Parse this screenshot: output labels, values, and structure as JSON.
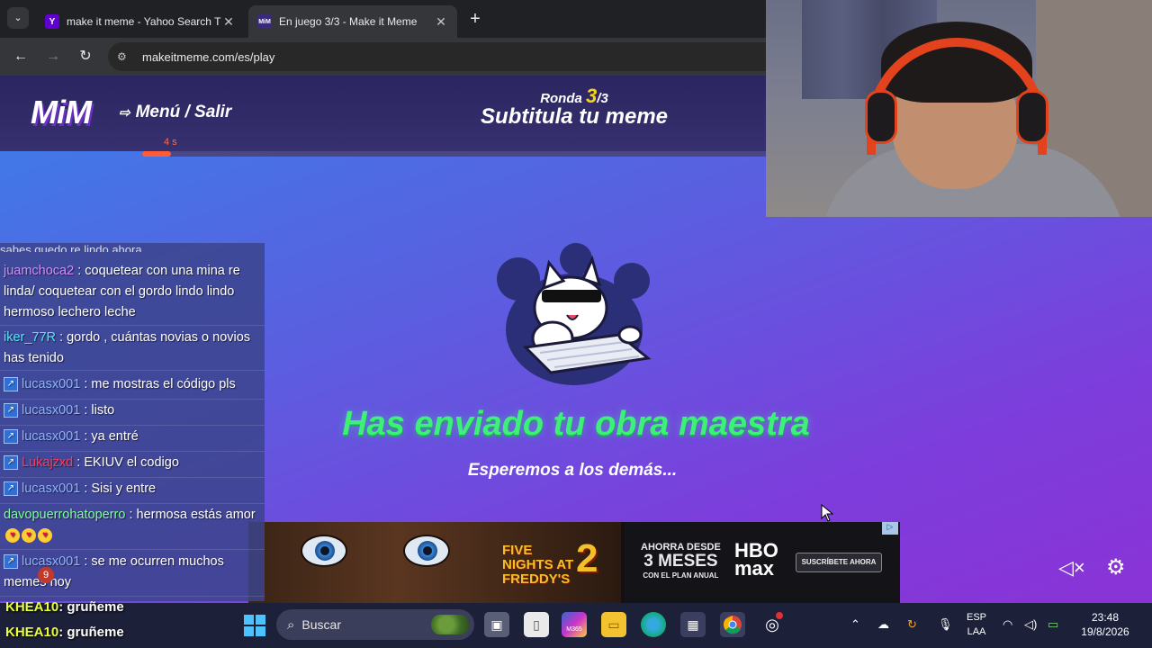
{
  "browser": {
    "tabs": [
      {
        "title": "make it meme - Yahoo Search T",
        "favicon": "Y",
        "active": false
      },
      {
        "title": "En juego 3/3 - Make it Meme",
        "favicon": "MiM",
        "active": true
      }
    ],
    "url": "makeitmeme.com/es/play"
  },
  "game": {
    "logo": "MiM",
    "menu_exit": "Menú / Salir",
    "round_prefix": "Ronda",
    "round_current": "3",
    "round_total": "/3",
    "round_subtitle": "Subtitula tu meme",
    "timer_label": "4 s",
    "timer_progress": 0.046,
    "sent_title": "Has enviado tu obra maestra",
    "sent_subtitle": "Esperemos a los demás..."
  },
  "ad": {
    "fnaf_title": "FIVE NIGHTS AT FREDDY'S",
    "fnaf_number": "2",
    "offer_line1": "AHORRA DESDE",
    "offer_line2": "3 MESES",
    "offer_line3": "CON EL PLAN ANUAL",
    "logo_hbo": "HBO",
    "logo_max": "max",
    "cta": "SUSCRÍBETE AHORA",
    "adchoices": "▷"
  },
  "chat": {
    "clipped_top": "sabes quedo re lindo ahora",
    "messages": [
      {
        "user": "juamchoca2",
        "color": "purple",
        "badge": false,
        "text": ": coquetear con una mina re linda/ coquetear con el gordo lindo lindo hermoso lechero leche"
      },
      {
        "user": "iker_77R",
        "color": "cyan",
        "badge": false,
        "text": ": gordo , cuántas novias o novios has tenido"
      },
      {
        "user": "lucasx001",
        "color": "blue",
        "badge": true,
        "text": ": me mostras el código pls"
      },
      {
        "user": "lucasx001",
        "color": "blue",
        "badge": true,
        "text": ": listo"
      },
      {
        "user": "lucasx001",
        "color": "blue",
        "badge": true,
        "text": ": ya entré"
      },
      {
        "user": "Lukajzxd",
        "color": "red",
        "badge": true,
        "text": ": EKIUV el codigo"
      },
      {
        "user": "lucasx001",
        "color": "blue",
        "badge": true,
        "text": ": Sisi y entre"
      },
      {
        "user": "davopuerrohatoperro",
        "color": "green",
        "badge": false,
        "text": ": hermosa estás amor"
      },
      {
        "user": "lucasx001",
        "color": "blue",
        "badge": true,
        "text": ": se me ocurren muchos memes hoy"
      }
    ],
    "notif_count": "9",
    "overlay": [
      {
        "user": "KHEA10",
        "text": ": gruñeme"
      },
      {
        "user": "KHEA10",
        "text": ": gruñeme"
      }
    ]
  },
  "taskbar": {
    "search_label": "Buscar",
    "m365_label": "M365",
    "lang_top": "ESP",
    "lang_bottom": "LAA",
    "time": "23:48",
    "date": "19/8/2026"
  }
}
